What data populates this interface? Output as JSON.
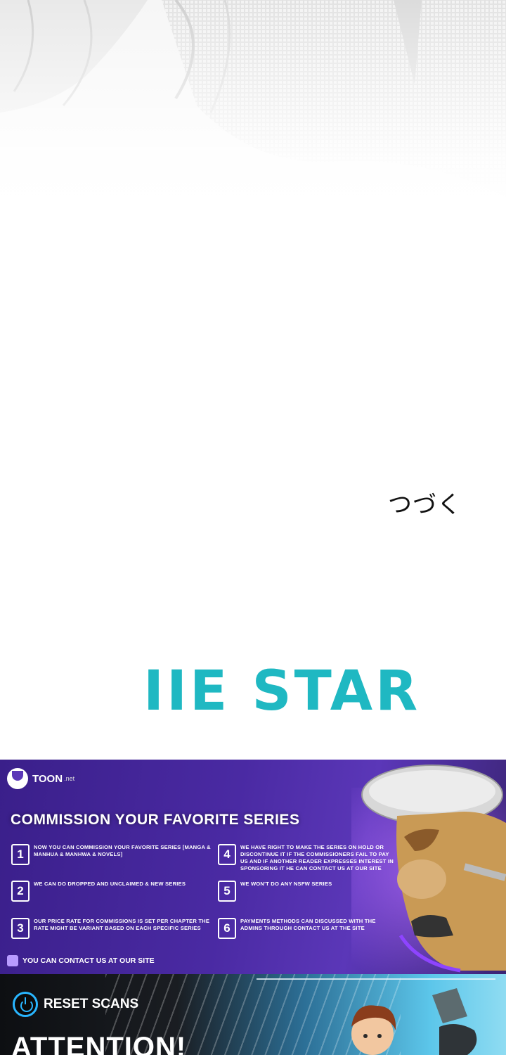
{
  "panel_end": {
    "text": "つづく"
  },
  "watermark": {
    "text": "IIE STAR",
    "color": "#1fb8c2"
  },
  "commission_banner": {
    "brand": "TOON",
    "brand_suffix": ".net",
    "title": "COMMISSION YOUR FAVORITE SERIES",
    "rules": [
      {
        "num": "1",
        "text": "NOW YOU CAN COMMISSION YOUR FAVORITE SERIES [MANGA & MANHUA & MANHWA  & NOVELS]"
      },
      {
        "num": "2",
        "text": "WE CAN DO DROPPED AND UNCLAIMED & NEW SERIES"
      },
      {
        "num": "3",
        "text": "OUR PRICE RATE FOR COMMISSIONS IS SET PER CHAPTER THE RATE MIGHT BE VARIANT BASED ON EACH SPECIFIC SERIES"
      },
      {
        "num": "4",
        "text": "WE HAVE RIGHT TO MAKE THE SERIES ON HOLD OR DISCONTINUE IT IF THE COMMISSIONERS FAIL TO PAY US AND IF ANOTHER READER EXPRESSES INTEREST IN SPONSORING IT  HE CAN CONTACT US AT OUR SITE"
      },
      {
        "num": "5",
        "text": "WE WON'T DO ANY NSFW SERIES"
      },
      {
        "num": "6",
        "text": "PAYMENTS METHODS CAN DISCUSSED WITH THE ADMINS THROUGH CONTACT US AT THE SITE"
      }
    ],
    "contact": "YOU CAN CONTACT US AT OUR SITE",
    "accent": "#4a2aa3"
  },
  "reset_banner": {
    "brand": "RESET SCANS",
    "headline": "ATTENTION!",
    "accent": "#29b6ff"
  }
}
